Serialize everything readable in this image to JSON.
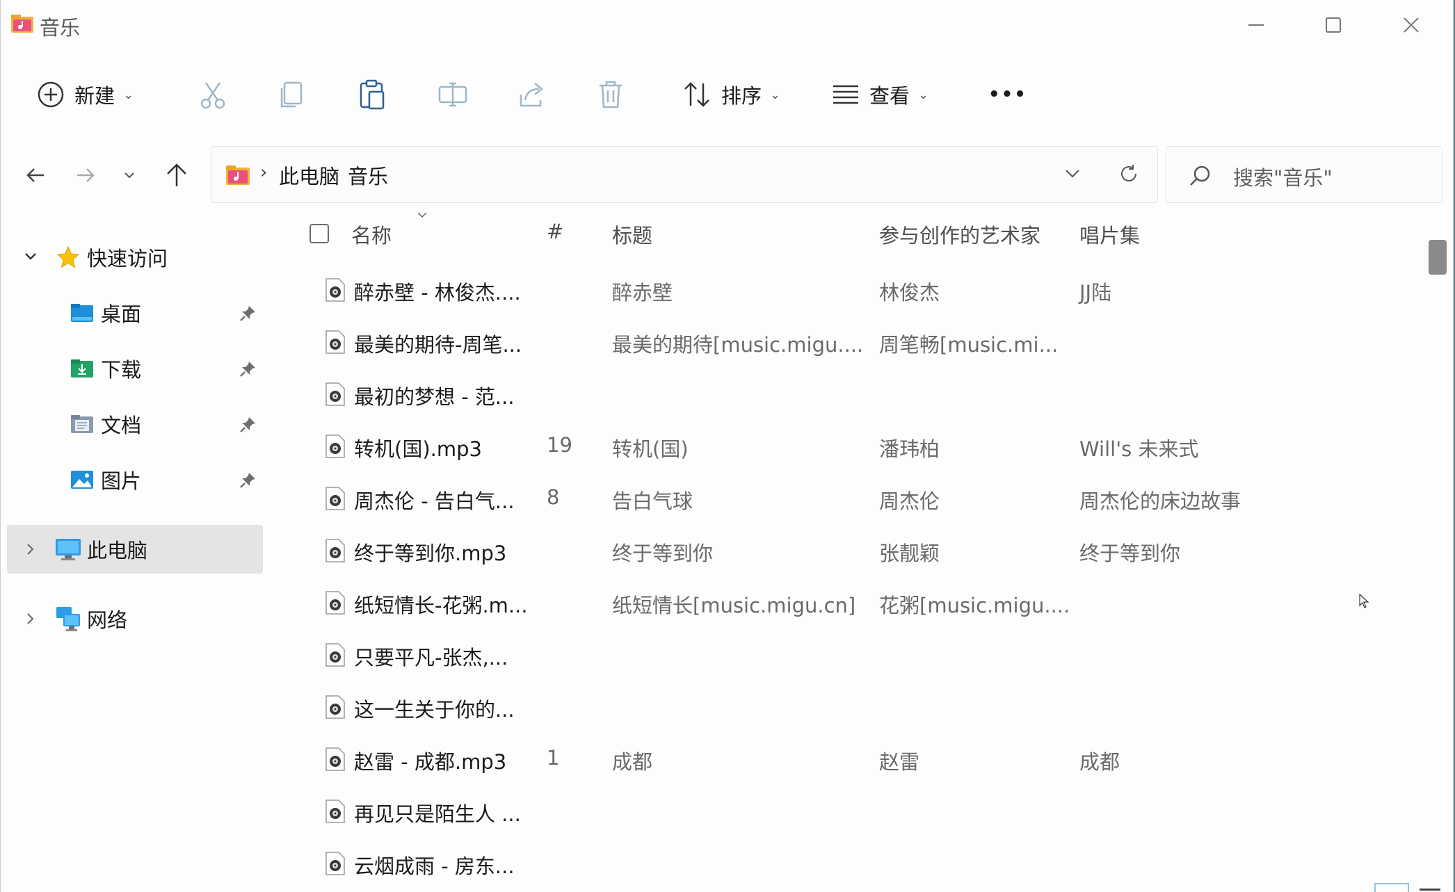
{
  "window": {
    "title": "音乐"
  },
  "toolbar": {
    "new_label": "新建",
    "sort_label": "排序",
    "view_label": "查看",
    "more_label": "•••"
  },
  "address": {
    "crumbs": [
      "此电脑",
      "音乐"
    ],
    "search_placeholder": "搜索\"音乐\""
  },
  "sidebar": {
    "quick_access": "快速访问",
    "items": [
      {
        "label": "桌面"
      },
      {
        "label": "下载"
      },
      {
        "label": "文档"
      },
      {
        "label": "图片"
      }
    ],
    "this_pc": "此电脑",
    "network": "网络"
  },
  "columns": {
    "name": "名称",
    "num": "#",
    "title": "标题",
    "artist": "参与创作的艺术家",
    "album": "唱片集"
  },
  "files": [
    {
      "name": "醉赤壁 - 林俊杰....",
      "num": "",
      "title": "醉赤壁",
      "artist": "林俊杰",
      "album": "JJ陆"
    },
    {
      "name": "最美的期待-周笔...",
      "num": "",
      "title": "最美的期待[music.migu....",
      "artist": "周笔畅[music.mi...",
      "album": ""
    },
    {
      "name": "最初的梦想 - 范...",
      "num": "",
      "title": "",
      "artist": "",
      "album": ""
    },
    {
      "name": "转机(国).mp3",
      "num": "19",
      "title": "转机(国)",
      "artist": "潘玮柏",
      "album": "Will's 未来式"
    },
    {
      "name": "周杰伦 - 告白气...",
      "num": "8",
      "title": "告白气球",
      "artist": "周杰伦",
      "album": "周杰伦的床边故事"
    },
    {
      "name": "终于等到你.mp3",
      "num": "",
      "title": "终于等到你",
      "artist": "张靓颖",
      "album": "终于等到你"
    },
    {
      "name": "纸短情长-花粥.m...",
      "num": "",
      "title": "纸短情长[music.migu.cn]",
      "artist": "花粥[music.migu....",
      "album": ""
    },
    {
      "name": "只要平凡-张杰,...",
      "num": "",
      "title": "",
      "artist": "",
      "album": ""
    },
    {
      "name": "这一生关于你的...",
      "num": "",
      "title": "",
      "artist": "",
      "album": ""
    },
    {
      "name": "赵雷 - 成都.mp3",
      "num": "1",
      "title": "成都",
      "artist": "赵雷",
      "album": "成都"
    },
    {
      "name": "再见只是陌生人 ...",
      "num": "",
      "title": "",
      "artist": "",
      "album": ""
    },
    {
      "name": "云烟成雨 - 房东...",
      "num": "",
      "title": "",
      "artist": "",
      "album": ""
    }
  ],
  "colors": {
    "accent": "#0067c0",
    "selected_bg": "#e4e4e4",
    "disabled_icon": "#9fb6c8"
  }
}
